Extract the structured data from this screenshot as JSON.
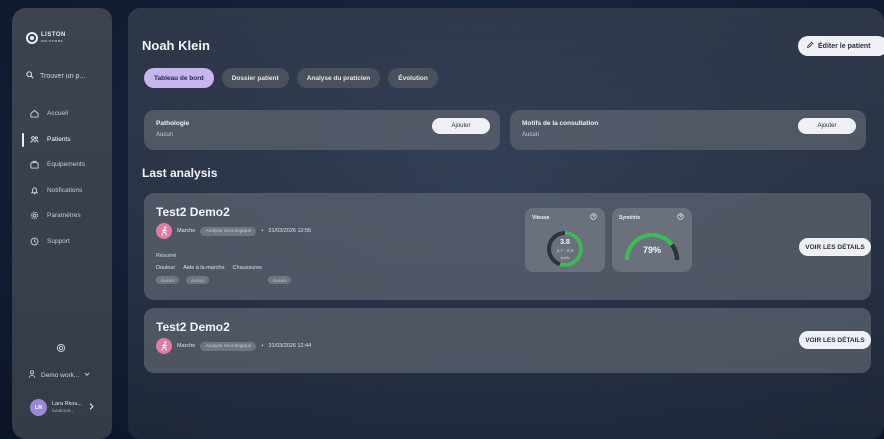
{
  "sidebar": {
    "logo": {
      "name": "LISTON",
      "sub": "SOLUTIONS"
    },
    "search_label": "Trouver un p...",
    "items": [
      {
        "label": "Accueil",
        "icon": "home-icon",
        "active": false
      },
      {
        "label": "Patients",
        "icon": "patients-icon",
        "active": true
      },
      {
        "label": "Equipements",
        "icon": "equipment-icon",
        "active": false
      },
      {
        "label": "Notifications",
        "icon": "bell-icon",
        "active": false
      },
      {
        "label": "Paramètres",
        "icon": "gear-icon",
        "active": false
      },
      {
        "label": "Support",
        "icon": "support-icon",
        "active": false
      }
    ],
    "workspace_label": "Demo work...",
    "user": {
      "initials": "LR",
      "name": "Lara Rkou...",
      "handle": "larakouri..."
    }
  },
  "header": {
    "patient_name": "Noah Klein",
    "edit_label": "Éditer le patient"
  },
  "tabs": [
    {
      "label": "Tableau de bord",
      "active": true
    },
    {
      "label": "Dossier patient",
      "active": false
    },
    {
      "label": "Analyse du praticien",
      "active": false
    },
    {
      "label": "Évolution",
      "active": false
    }
  ],
  "pathologie": {
    "title": "Pathologie",
    "value": "Aucun",
    "button": "Ajouter"
  },
  "motifs": {
    "title": "Motifs de la consultation",
    "value": "Aucun",
    "button": "Ajouter"
  },
  "last_analysis_title": "Last analysis",
  "analyses": [
    {
      "title": "Test2 Demo2",
      "type": "Marche",
      "tag": "Analyse neurologique",
      "date": "31/03/2026 12:55",
      "resume_label": "Résumé",
      "fields": [
        "Douleur",
        "Aide à la marche",
        "Chaussures"
      ],
      "field_values": [
        "Aucun",
        "Aucun",
        "Aucun"
      ],
      "vitesse": {
        "label": "Vitesse",
        "value": "3.8",
        "range": "2.7 - 6.6",
        "unit": "km/h",
        "fraction": 0.55
      },
      "symetrie": {
        "label": "Symétrie",
        "value": "79%",
        "fraction": 0.79
      },
      "details_label": "VOIR LES DÉTAILS"
    },
    {
      "title": "Test2 Demo2",
      "type": "Marche",
      "tag": "Analyse neurologique",
      "date": "31/03/2026 12:44",
      "details_label": "VOIR LES DÉTAILS"
    }
  ],
  "colors": {
    "accent_tab": "#c7b5ef",
    "gauge_green": "#3fb85a",
    "walk_icon": "#e27aa6"
  }
}
